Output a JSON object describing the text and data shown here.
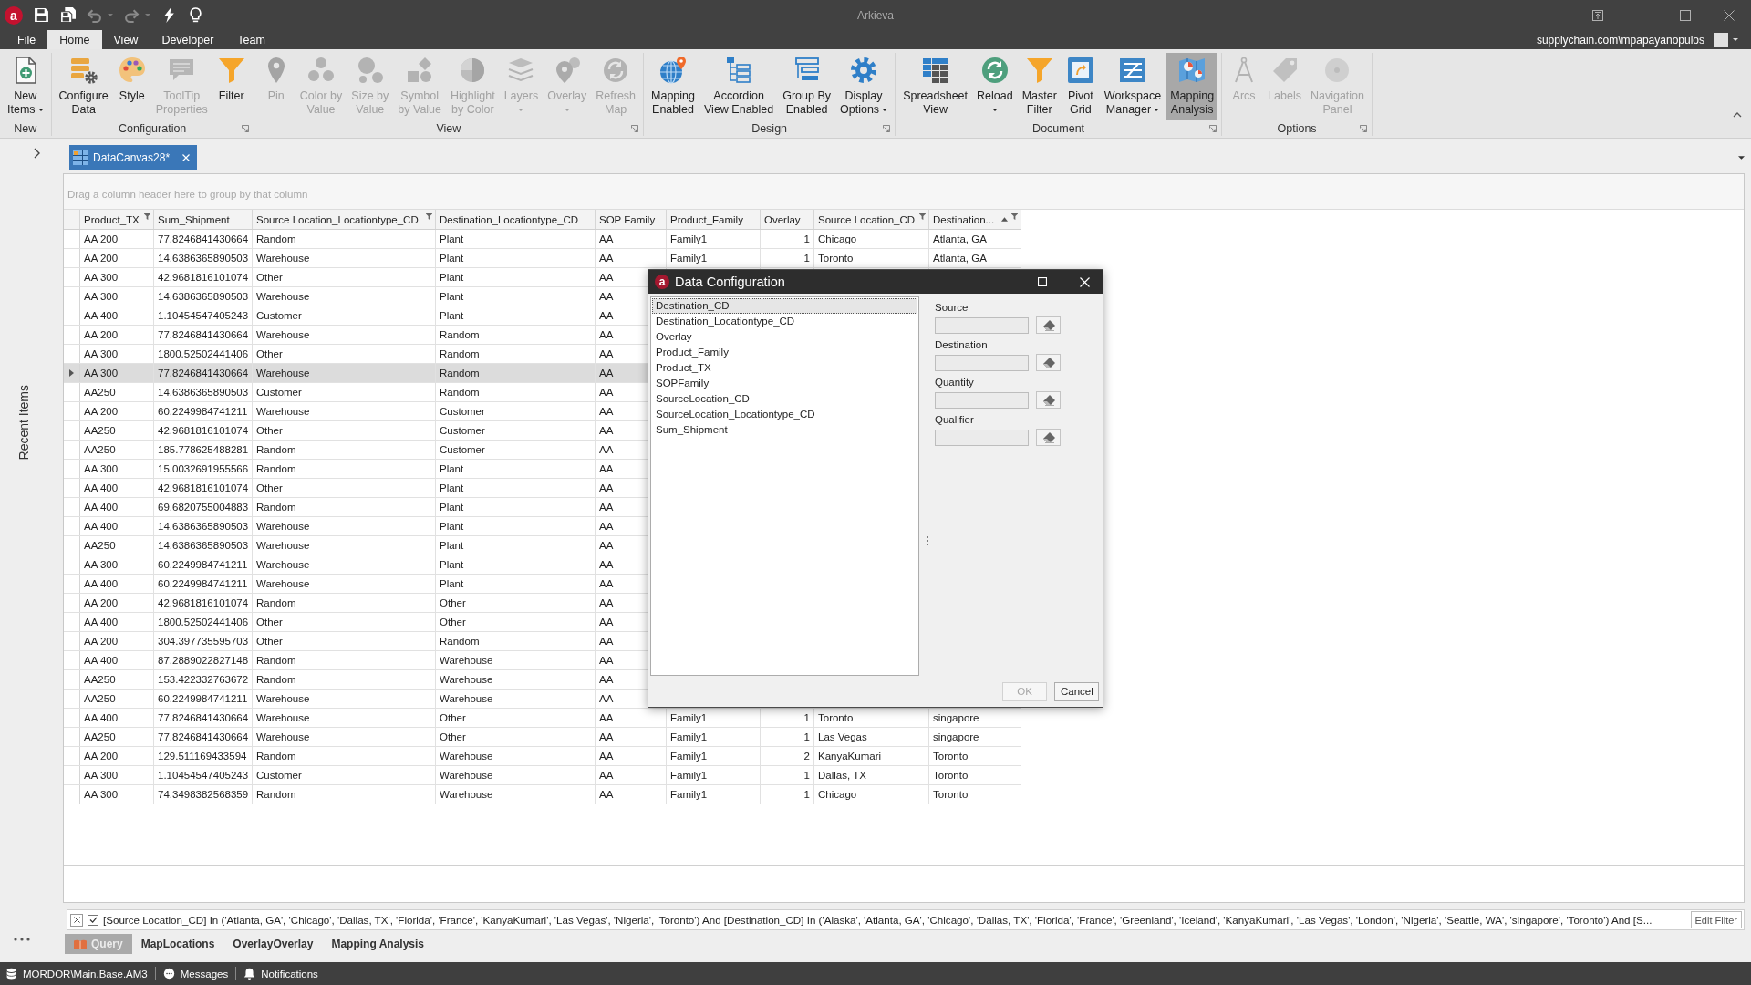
{
  "window": {
    "logo": "a",
    "title": "Arkieva"
  },
  "quick_access": [
    {
      "disabled": false,
      "dropdown": false
    },
    {
      "disabled": false,
      "dropdown": false
    },
    {
      "disabled": true,
      "dropdown": true
    },
    {
      "disabled": true,
      "dropdown": true
    },
    {
      "disabled": false,
      "dropdown": false
    },
    {
      "disabled": false,
      "dropdown": false
    }
  ],
  "menu_tabs": [
    {
      "label": "File",
      "selected": false
    },
    {
      "label": "Home",
      "selected": true
    },
    {
      "label": "View",
      "selected": false
    },
    {
      "label": "Developer",
      "selected": false
    },
    {
      "label": "Team",
      "selected": false
    }
  ],
  "account": {
    "user": "supplychain.com\\mpapayanopulos"
  },
  "ribbon": {
    "groups": [
      {
        "label": "New",
        "launcher": false,
        "buttons": [
          {
            "lines": [
              "New",
              "Items"
            ],
            "dropdown": true,
            "disabled": false,
            "selected": false
          }
        ]
      },
      {
        "label": "Configuration",
        "launcher": true,
        "buttons": [
          {
            "lines": [
              "Configure",
              "Data"
            ],
            "dropdown": false,
            "disabled": false,
            "selected": false
          },
          {
            "lines": [
              "Style"
            ],
            "dropdown": false,
            "disabled": false,
            "selected": false
          },
          {
            "lines": [
              "ToolTip",
              "Properties"
            ],
            "dropdown": false,
            "disabled": true,
            "selected": false
          },
          {
            "lines": [
              "Filter"
            ],
            "dropdown": false,
            "disabled": false,
            "selected": false
          }
        ]
      },
      {
        "label": "View",
        "launcher": true,
        "buttons": [
          {
            "lines": [
              "Pin"
            ],
            "dropdown": false,
            "disabled": true,
            "selected": false
          },
          {
            "lines": [
              "Color by",
              "Value"
            ],
            "dropdown": false,
            "disabled": true,
            "selected": false
          },
          {
            "lines": [
              "Size by",
              "Value"
            ],
            "dropdown": false,
            "disabled": true,
            "selected": false
          },
          {
            "lines": [
              "Symbol",
              "by Value"
            ],
            "dropdown": false,
            "disabled": true,
            "selected": false
          },
          {
            "lines": [
              "Highlight",
              "by Color"
            ],
            "dropdown": false,
            "disabled": true,
            "selected": false
          },
          {
            "lines": [
              "Layers"
            ],
            "dropdown": true,
            "disabled": true,
            "selected": false
          },
          {
            "lines": [
              "Overlay"
            ],
            "dropdown": true,
            "disabled": true,
            "selected": false
          },
          {
            "lines": [
              "Refresh",
              "Map"
            ],
            "dropdown": false,
            "disabled": true,
            "selected": false
          }
        ]
      },
      {
        "label": "Design",
        "launcher": true,
        "buttons": [
          {
            "lines": [
              "Mapping",
              "Enabled"
            ],
            "dropdown": false,
            "disabled": false,
            "selected": false
          },
          {
            "lines": [
              "Accordion",
              "View Enabled"
            ],
            "dropdown": false,
            "disabled": false,
            "selected": false
          },
          {
            "lines": [
              "Group By",
              "Enabled"
            ],
            "dropdown": false,
            "disabled": false,
            "selected": false
          },
          {
            "lines": [
              "Display",
              "Options"
            ],
            "dropdown": true,
            "disabled": false,
            "selected": false
          }
        ]
      },
      {
        "label": "Document",
        "launcher": true,
        "buttons": [
          {
            "lines": [
              "Spreadsheet",
              "View"
            ],
            "dropdown": false,
            "disabled": false,
            "selected": false
          },
          {
            "lines": [
              "Reload"
            ],
            "dropdown": true,
            "disabled": false,
            "selected": false
          },
          {
            "lines": [
              "Master",
              "Filter"
            ],
            "dropdown": false,
            "disabled": false,
            "selected": false
          },
          {
            "lines": [
              "Pivot",
              "Grid"
            ],
            "dropdown": false,
            "disabled": false,
            "selected": false
          },
          {
            "lines": [
              "Workspace",
              "Manager"
            ],
            "dropdown": true,
            "disabled": false,
            "selected": false
          },
          {
            "lines": [
              "Mapping",
              "Analysis"
            ],
            "dropdown": false,
            "disabled": false,
            "selected": true
          }
        ]
      },
      {
        "label": "Options",
        "launcher": true,
        "buttons": [
          {
            "lines": [
              "Arcs"
            ],
            "dropdown": false,
            "disabled": true,
            "selected": false
          },
          {
            "lines": [
              "Labels"
            ],
            "dropdown": false,
            "disabled": true,
            "selected": false
          },
          {
            "lines": [
              "Navigation",
              "Panel"
            ],
            "dropdown": false,
            "disabled": true,
            "selected": false
          }
        ]
      }
    ]
  },
  "document_tabs": [
    {
      "label": "DataCanvas28*",
      "selected": true
    }
  ],
  "sidebar": {
    "label": "Recent Items"
  },
  "grid": {
    "group_panel": {
      "placeholder": "Drag a column header here to group by that column"
    },
    "columns": [
      {
        "label": "Product_TX",
        "kind": "text",
        "filtered": true,
        "sorted": false
      },
      {
        "label": "Sum_Shipment",
        "kind": "text",
        "filtered": false,
        "sorted": false
      },
      {
        "label": "Source Location_Locationtype_CD",
        "kind": "text",
        "filtered": true,
        "sorted": false
      },
      {
        "label": "Destination_Locationtype_CD",
        "kind": "text",
        "filtered": false,
        "sorted": false
      },
      {
        "label": "SOP Family",
        "kind": "text",
        "filtered": false,
        "sorted": false
      },
      {
        "label": "Product_Family",
        "kind": "text",
        "filtered": false,
        "sorted": false
      },
      {
        "label": "Overlay",
        "kind": "number",
        "filtered": false,
        "sorted": false
      },
      {
        "label": "Source Location_CD",
        "kind": "text",
        "filtered": true,
        "sorted": false
      },
      {
        "label": "Destination...",
        "kind": "text",
        "filtered": true,
        "sorted": true
      }
    ],
    "rows": [
      {
        "selected": false,
        "cells": [
          "AA 200",
          "77.8246841430664",
          "Random",
          "Plant",
          "AA",
          "Family1",
          "1",
          "Chicago",
          "Atlanta, GA"
        ]
      },
      {
        "selected": false,
        "cells": [
          "AA 200",
          "14.6386365890503",
          "Warehouse",
          "Plant",
          "AA",
          "Family1",
          "1",
          "Toronto",
          "Atlanta, GA"
        ]
      },
      {
        "selected": false,
        "cells": [
          "AA 300",
          "42.9681816101074",
          "Other",
          "Plant",
          "AA"
        ]
      },
      {
        "selected": false,
        "cells": [
          "AA 300",
          "14.6386365890503",
          "Warehouse",
          "Plant",
          "AA"
        ]
      },
      {
        "selected": false,
        "cells": [
          "AA 400",
          "1.10454547405243",
          "Customer",
          "Plant",
          "AA"
        ]
      },
      {
        "selected": false,
        "cells": [
          "AA 200",
          "77.8246841430664",
          "Warehouse",
          "Random",
          "AA"
        ]
      },
      {
        "selected": false,
        "cells": [
          "AA 300",
          "1800.52502441406",
          "Other",
          "Random",
          "AA"
        ]
      },
      {
        "selected": true,
        "cells": [
          "AA 300",
          "77.8246841430664",
          "Warehouse",
          "Random",
          "AA"
        ]
      },
      {
        "selected": false,
        "cells": [
          "AA250",
          "14.6386365890503",
          "Customer",
          "Random",
          "AA"
        ]
      },
      {
        "selected": false,
        "cells": [
          "AA 200",
          "60.2249984741211",
          "Warehouse",
          "Customer",
          "AA"
        ]
      },
      {
        "selected": false,
        "cells": [
          "AA250",
          "42.9681816101074",
          "Other",
          "Customer",
          "AA"
        ]
      },
      {
        "selected": false,
        "cells": [
          "AA250",
          "185.778625488281",
          "Random",
          "Customer",
          "AA"
        ]
      },
      {
        "selected": false,
        "cells": [
          "AA 300",
          "15.0032691955566",
          "Random",
          "Plant",
          "AA"
        ]
      },
      {
        "selected": false,
        "cells": [
          "AA 400",
          "42.9681816101074",
          "Other",
          "Plant",
          "AA"
        ]
      },
      {
        "selected": false,
        "cells": [
          "AA 400",
          "69.6820755004883",
          "Random",
          "Plant",
          "AA"
        ]
      },
      {
        "selected": false,
        "cells": [
          "AA 400",
          "14.6386365890503",
          "Warehouse",
          "Plant",
          "AA"
        ]
      },
      {
        "selected": false,
        "cells": [
          "AA250",
          "14.6386365890503",
          "Warehouse",
          "Plant",
          "AA"
        ]
      },
      {
        "selected": false,
        "cells": [
          "AA 300",
          "60.2249984741211",
          "Warehouse",
          "Plant",
          "AA"
        ]
      },
      {
        "selected": false,
        "cells": [
          "AA 400",
          "60.2249984741211",
          "Warehouse",
          "Plant",
          "AA"
        ]
      },
      {
        "selected": false,
        "cells": [
          "AA 200",
          "42.9681816101074",
          "Random",
          "Other",
          "AA"
        ]
      },
      {
        "selected": false,
        "cells": [
          "AA 400",
          "1800.52502441406",
          "Other",
          "Other",
          "AA"
        ]
      },
      {
        "selected": false,
        "cells": [
          "AA 200",
          "304.397735595703",
          "Other",
          "Random",
          "AA"
        ]
      },
      {
        "selected": false,
        "cells": [
          "AA 400",
          "87.2889022827148",
          "Random",
          "Warehouse",
          "AA"
        ]
      },
      {
        "selected": false,
        "cells": [
          "AA250",
          "153.422332763672",
          "Random",
          "Warehouse",
          "AA"
        ]
      },
      {
        "selected": false,
        "cells": [
          "AA250",
          "60.2249984741211",
          "Warehouse",
          "Warehouse",
          "AA"
        ]
      },
      {
        "selected": false,
        "cells": [
          "AA 400",
          "77.8246841430664",
          "Warehouse",
          "Other",
          "AA",
          "Family1",
          "1",
          "Toronto",
          "singapore"
        ]
      },
      {
        "selected": false,
        "cells": [
          "AA250",
          "77.8246841430664",
          "Warehouse",
          "Other",
          "AA",
          "Family1",
          "1",
          "Las Vegas",
          "singapore"
        ]
      },
      {
        "selected": false,
        "cells": [
          "AA 200",
          "129.511169433594",
          "Random",
          "Warehouse",
          "AA",
          "Family1",
          "2",
          "KanyaKumari",
          "Toronto"
        ]
      },
      {
        "selected": false,
        "cells": [
          "AA 300",
          "1.10454547405243",
          "Customer",
          "Warehouse",
          "AA",
          "Family1",
          "1",
          "Dallas, TX",
          "Toronto"
        ]
      },
      {
        "selected": false,
        "cells": [
          "AA 300",
          "74.3498382568359",
          "Random",
          "Warehouse",
          "AA",
          "Family1",
          "1",
          "Chicago",
          "Toronto"
        ]
      }
    ]
  },
  "dialog": {
    "logo": "a",
    "title": "Data Configuration",
    "fields": [
      {
        "label": "Destination_CD",
        "selected": true
      },
      {
        "label": "Destination_Locationtype_CD",
        "selected": false
      },
      {
        "label": "Overlay",
        "selected": false
      },
      {
        "label": "Product_Family",
        "selected": false
      },
      {
        "label": "Product_TX",
        "selected": false
      },
      {
        "label": "SOPFamily",
        "selected": false
      },
      {
        "label": "SourceLocation_CD",
        "selected": false
      },
      {
        "label": "SourceLocation_Locationtype_CD",
        "selected": false
      },
      {
        "label": "Sum_Shipment",
        "selected": false
      }
    ],
    "mappings": [
      {
        "label": "Source"
      },
      {
        "label": "Destination"
      },
      {
        "label": "Quantity"
      },
      {
        "label": "Qualifier"
      }
    ],
    "buttons": [
      {
        "label": "OK",
        "disabled": true
      },
      {
        "label": "Cancel",
        "disabled": false
      }
    ]
  },
  "filter_bar": {
    "enabled": true,
    "expression": "[Source Location_CD] In ('Atlanta, GA', 'Chicago', 'Dallas, TX', 'Florida', 'France', 'KanyaKumari', 'Las Vegas', 'Nigeria', 'Toronto') And [Destination_CD] In ('Alaska', 'Atlanta, GA', 'Chicago', 'Dallas, TX', 'Florida', 'France', 'Greenland', 'Iceland', 'KanyaKumari', 'Las Vegas', 'London', 'Nigeria', 'Seattle, WA', 'singapore', 'Toronto') And [S...",
    "button": "Edit Filter"
  },
  "sheet_tabs": [
    {
      "label": "Query",
      "kind": "query",
      "selected": true
    },
    {
      "label": "MapLocations",
      "kind": "map",
      "selected": false
    },
    {
      "label": "OverlayOverlay",
      "kind": "map",
      "selected": false
    },
    {
      "label": "Mapping Analysis",
      "kind": "map",
      "selected": false
    }
  ],
  "status_bar": [
    {
      "label": "MORDOR\\Main.Base.AM3"
    },
    {
      "label": "Messages"
    },
    {
      "label": "Notifications"
    }
  ]
}
